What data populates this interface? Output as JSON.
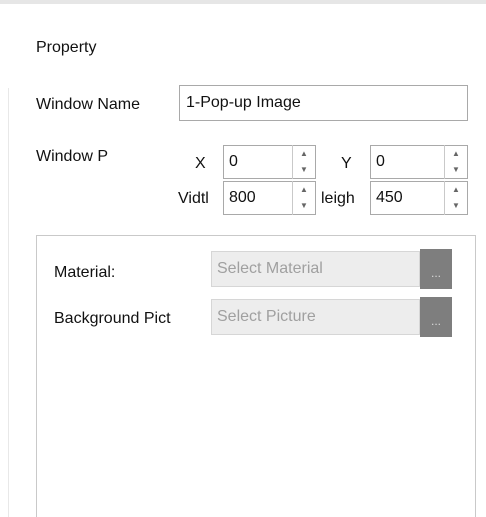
{
  "section_title": "Property",
  "window_name": {
    "label": "Window Name",
    "value": "1-Pop-up Image"
  },
  "window_position": {
    "label": "Window P",
    "x_label": "X",
    "x_value": "0",
    "y_label": "Y",
    "y_value": "0",
    "width_label": "Vidtl",
    "width_value": "800",
    "height_label": "leigh",
    "height_value": "450",
    "spin_up_icon": "caret-up",
    "spin_down_icon": "caret-down"
  },
  "material": {
    "label": "Material:",
    "placeholder": "Select Material",
    "browse_label": "..."
  },
  "background_picture": {
    "label": "Background Pict",
    "placeholder": "Select Picture",
    "browse_label": "..."
  },
  "colors": {
    "browse_button": "#7e7e7e",
    "select_field_bg": "#ededed",
    "placeholder_text": "#a0a0a0"
  }
}
